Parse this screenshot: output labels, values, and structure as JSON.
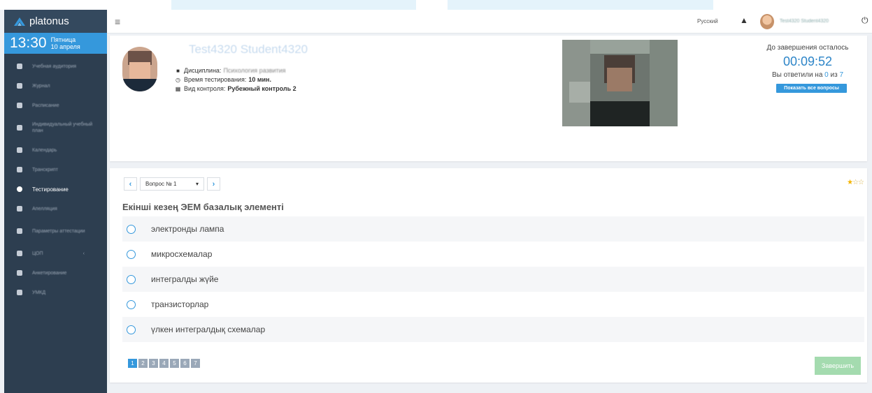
{
  "app": {
    "logo_text": "platonus"
  },
  "clock": {
    "time": "13:30",
    "weekday": "Пятница",
    "date": "10 апреля"
  },
  "sidebar": {
    "items": [
      {
        "label": "Учебная аудитория",
        "icon": "building-icon"
      },
      {
        "label": "Журнал",
        "icon": "book-icon"
      },
      {
        "label": "Расписание",
        "icon": "clock-icon"
      },
      {
        "label": "Индивидуальный учебный план",
        "icon": "list-icon"
      },
      {
        "label": "Календарь",
        "icon": "calendar-icon"
      },
      {
        "label": "Транскрипт",
        "icon": "document-icon"
      },
      {
        "label": "Тестирование",
        "icon": "question-icon",
        "active": true
      },
      {
        "label": "Апелляция",
        "icon": "hammer-icon"
      },
      {
        "label": "Параметры аттестации",
        "icon": "gavel-icon"
      },
      {
        "label": "ЦОП",
        "icon": "user-icon"
      },
      {
        "label": "Анкетирование",
        "icon": "chat-icon"
      },
      {
        "label": "УМКД",
        "icon": "folder-icon"
      }
    ]
  },
  "header": {
    "language": "Русский",
    "user_name": "Test4320 Student4320",
    "icons": {
      "menu": "hamburger-icon",
      "alert": "warning-icon",
      "logout": "power-icon"
    }
  },
  "test_info": {
    "student_name": "Test4320 Student4320",
    "discipline_label": "Дисциплина:",
    "discipline_value": "Психология развития",
    "duration_label": "Время тестирования:",
    "duration_value": "10 мин.",
    "control_label": "Вид контроля:",
    "control_value": "Рубежный контроль 2"
  },
  "timer": {
    "label": "До завершения осталось",
    "value": "00:09:52",
    "answered_prefix": "Вы ответили на",
    "answered_count": "0",
    "answered_mid": "из",
    "answered_total": "7",
    "show_all_label": "Показать все вопросы"
  },
  "question": {
    "selector_label": "Вопрос № 1",
    "title": "Екінші кезең ЭЕМ базалық элементі",
    "difficulty_stars_filled": 1,
    "difficulty_stars_total": 3,
    "options": [
      "электронды лампа",
      "микросхемалар",
      "интегралды жүйе",
      "транзисторлар",
      "үлкен интегралдық схемалар"
    ]
  },
  "pagination": {
    "pages": [
      "1",
      "2",
      "3",
      "4",
      "5",
      "6",
      "7"
    ],
    "current": "1"
  },
  "finish_label": "Завершить",
  "colors": {
    "accent": "#3598dc",
    "sidebar": "#2d3e50",
    "finish": "#a4dbaf"
  }
}
